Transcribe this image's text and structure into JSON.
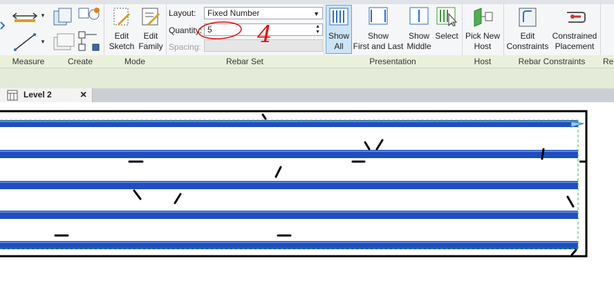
{
  "ribbon": {
    "panels": {
      "measure": "Measure",
      "create": "Create",
      "mode": "Mode",
      "rebar_set": "Rebar Set",
      "presentation": "Presentation",
      "host": "Host",
      "rebar_constraints": "Rebar Constraints",
      "cut_off": "Re"
    },
    "mode": {
      "edit_sketch": [
        "Edit",
        "Sketch"
      ],
      "edit_family": [
        "Edit",
        "Family"
      ]
    },
    "rebar_set": {
      "layout_label": "Layout:",
      "layout_value": "Fixed Number",
      "quantity_label": "Quantity:",
      "quantity_value": "5",
      "spacing_label": "Spacing:",
      "annotation_text": "4"
    },
    "presentation": {
      "show_all": [
        "Show",
        "All"
      ],
      "show_first_last": [
        "Show",
        "First and Last"
      ],
      "show_middle": [
        "Show",
        "Middle"
      ],
      "select": "Select"
    },
    "host": {
      "pick_new_host": [
        "Pick New",
        "Host"
      ]
    },
    "constraints": {
      "edit_constraints": [
        "Edit",
        "Constraints"
      ],
      "constrained_placement": [
        "Constrained",
        "Placement"
      ]
    }
  },
  "view_tab": {
    "label": "Level 2",
    "close": "×"
  },
  "colors": {
    "rebar_blue": "#1f4fbf",
    "rebar_highlight": "#5b86e5",
    "annotation_red": "#e01010",
    "active_button": "#cde4f7",
    "panel_footer": "#e9f0dc"
  }
}
